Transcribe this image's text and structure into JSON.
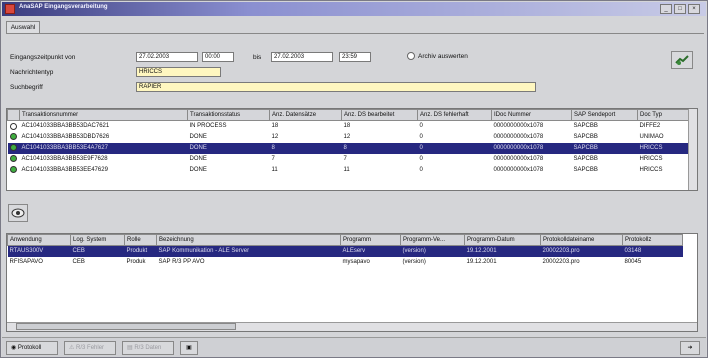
{
  "window": {
    "title": "AnaSAP Eingangsverarbeitung"
  },
  "tab": {
    "label": "Auswahl"
  },
  "form": {
    "from_label": "Eingangszeitpunkt von",
    "from_date": "27.02.2003",
    "from_time": "00:00",
    "to_label": "bis",
    "to_date": "27.02.2003",
    "to_time": "23:59",
    "archive_label": "Archiv auswerten",
    "msgtype_label": "Nachrichtentyp",
    "msgtype_value": "HRICCS",
    "search_label": "Suchbegriff",
    "search_value": "RAPIER"
  },
  "grid1": {
    "columns": [
      "Transaktionsnummer",
      "Transaktionsstatus",
      "Anz. Datensätze",
      "Anz. DS bearbeitet",
      "Anz. DS fehlerhaft",
      "IDoc Nummer",
      "SAP Sendeport",
      "Doc Typ"
    ],
    "rows": [
      {
        "status": "open",
        "tx": "AC1041033BBA3BB53DAC7621",
        "state": "IN PROCESS",
        "n": "18",
        "done": "18",
        "err": "0",
        "idoc": "0000000000x1078",
        "port": "SAPCBB",
        "doc": "DIFFE2"
      },
      {
        "status": "done",
        "tx": "AC1041033BBA3BB53DBD7626",
        "state": "DONE",
        "n": "12",
        "done": "12",
        "err": "0",
        "idoc": "0000000000x1078",
        "port": "SAPCBB",
        "doc": "UNIMAO"
      },
      {
        "status": "done",
        "tx": "AC1041033BBA3BB53E4A7627",
        "state": "DONE",
        "n": "8",
        "done": "8",
        "err": "0",
        "idoc": "0000000000x1078",
        "port": "SAPCBB",
        "doc": "HRICCS",
        "selected": true
      },
      {
        "status": "done",
        "tx": "AC1041033BBA3BB53E9F7628",
        "state": "DONE",
        "n": "7",
        "done": "7",
        "err": "0",
        "idoc": "0000000000x1078",
        "port": "SAPCBB",
        "doc": "HRICCS"
      },
      {
        "status": "done",
        "tx": "AC1041033BBA3BB53EE47629",
        "state": "DONE",
        "n": "11",
        "done": "11",
        "err": "0",
        "idoc": "0000000000x1078",
        "port": "SAPCBB",
        "doc": "HRICCS"
      }
    ]
  },
  "grid2": {
    "columns": [
      "Anwendung",
      "Log. System",
      "Rolle",
      "Bezeichnung",
      "Programm",
      "Programm-Ve...",
      "Programm-Datum",
      "Protokolldateiname",
      "Protokollz"
    ],
    "rows": [
      {
        "app": "RTAUS300V",
        "sys": "CEB",
        "role": "Produkt",
        "desc": "SAP Kommunikation - ALE Server",
        "prog": "ALEserv",
        "ver": "(version)",
        "date": "19.12.2001",
        "log": "20002203.pro",
        "logz": "03148",
        "selected": true
      },
      {
        "app": "RFISAPAVO",
        "sys": "CEB",
        "role": "Produk",
        "desc": "SAP R/3 PP AVO",
        "prog": "mysapavo",
        "ver": "(version)",
        "date": "19.12.2001",
        "log": "20002203.pro",
        "logz": "80045"
      }
    ]
  },
  "bottom": {
    "btn1": "Protokoll",
    "btn2": "R/3 Fehler",
    "btn3": "R/3 Daten"
  },
  "colors": {
    "selection": "#262880",
    "titlebar": "#3a3c7e",
    "highlight_field": "#fff7c0"
  }
}
